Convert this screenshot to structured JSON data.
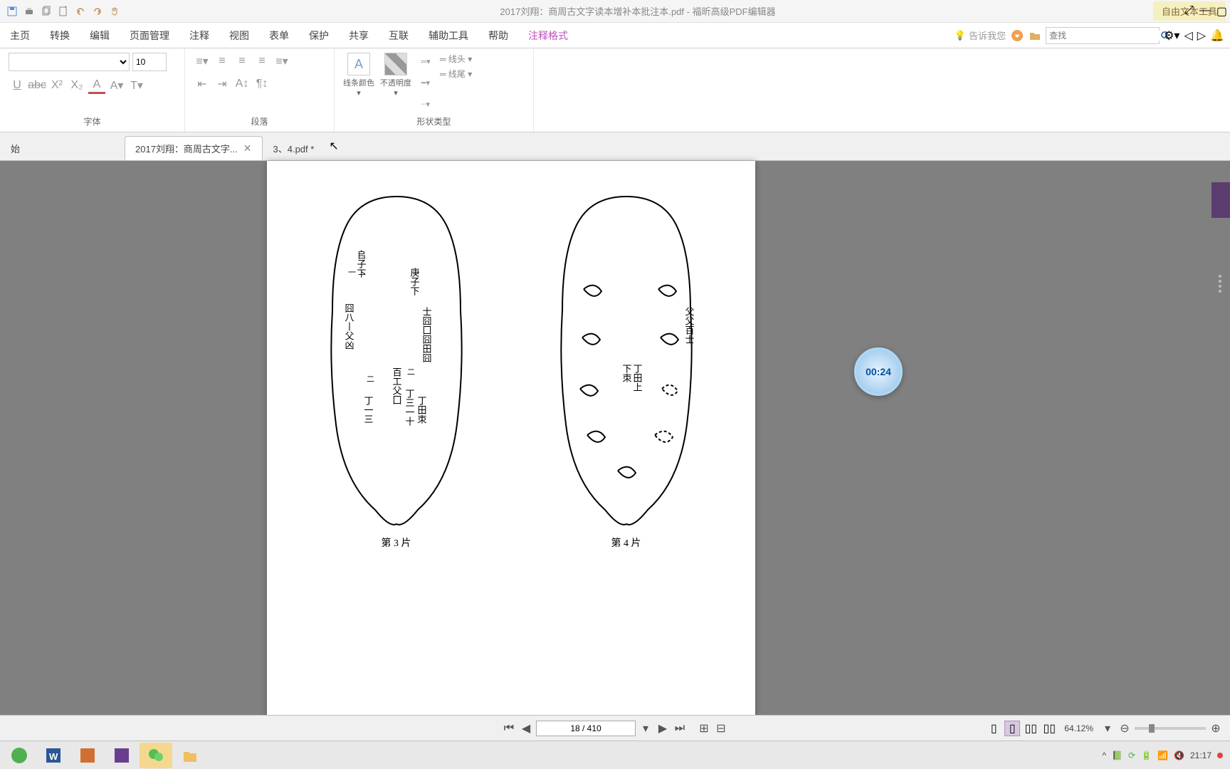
{
  "window": {
    "title": "2017刘翔：商周古文字读本增补本批注本.pdf - 福昕高级PDF编辑器",
    "tool_tag": "自由文本工具"
  },
  "ribbon": {
    "tabs": [
      "主页",
      "转换",
      "编辑",
      "页面管理",
      "注释",
      "视图",
      "表单",
      "保护",
      "共享",
      "互联",
      "辅助工具",
      "帮助",
      "注释格式"
    ],
    "active_tab": 12,
    "ask_me": "告诉我您",
    "search_placeholder": "查找",
    "font_size": "10",
    "groups": {
      "font": "字体",
      "paragraph": "段落",
      "shape": "形状类型"
    },
    "big_buttons": {
      "line_color": "线条颜色",
      "opacity": "不透明度",
      "line_head": "线头",
      "line_tail": "线尾"
    }
  },
  "doc_tabs": {
    "start": "始",
    "items": [
      {
        "label": "2017刘翔：商周古文字...",
        "active": true
      },
      {
        "label": "3、4.pdf *",
        "active": false
      }
    ]
  },
  "page": {
    "caption_left": "第 3 片",
    "caption_right": "第 4 片"
  },
  "status": {
    "page_display": "18 / 410",
    "zoom": "64.12%"
  },
  "timer": "00:24",
  "taskbar": {
    "clock": "21:17"
  }
}
